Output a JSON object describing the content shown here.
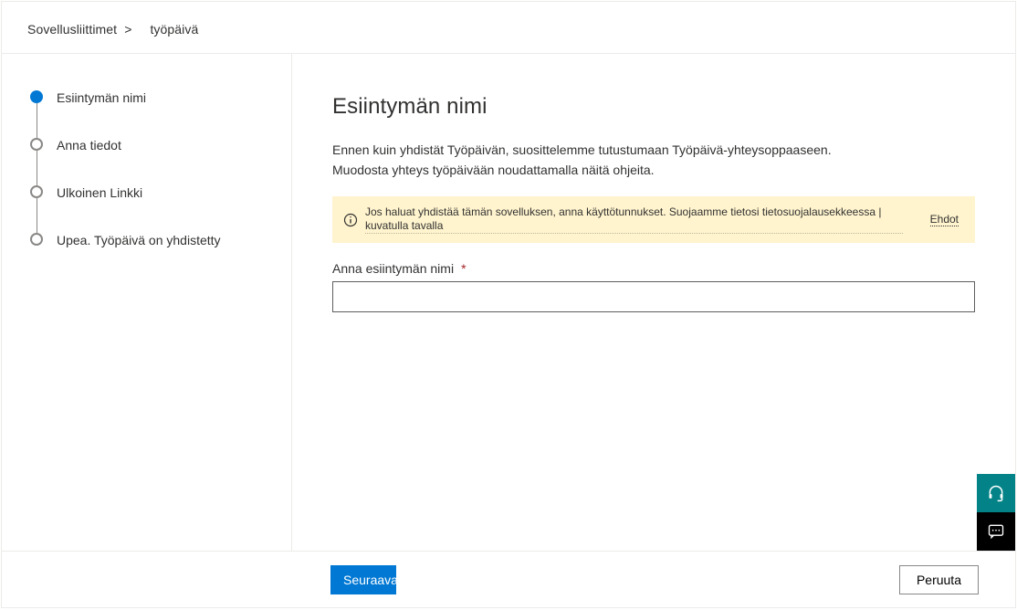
{
  "breadcrumb": {
    "root": "Sovellusliittimet",
    "separator": ">",
    "current": "työpäivä"
  },
  "steps": [
    {
      "label": "Esiintymän nimi",
      "active": true,
      "dotted": false
    },
    {
      "label": "Anna tiedot",
      "active": false,
      "dotted": true
    },
    {
      "label": "Ulkoinen  Linkki",
      "active": false,
      "dotted": false
    },
    {
      "label": "Upea. Työpäivä on yhdistetty",
      "active": false,
      "dotted": false
    }
  ],
  "main": {
    "title": "Esiintymän nimi",
    "desc_line1": "Ennen kuin yhdistät Työpäivän, suosittelemme tutustumaan Työpäivä-yhteysoppaaseen.",
    "desc_line2": "Muodosta yhteys työpäivään noudattamalla näitä ohjeita.",
    "notice_text": "Jos haluat yhdistää tämän sovelluksen, anna käyttötunnukset. Suojaamme tietosi tietosuojalausekkeessa | kuvatulla tavalla",
    "notice_link": "Ehdot",
    "field_label": "Anna esiintymän nimi",
    "field_value": ""
  },
  "footer": {
    "next": "Seuraava",
    "cancel": "Peruuta"
  }
}
